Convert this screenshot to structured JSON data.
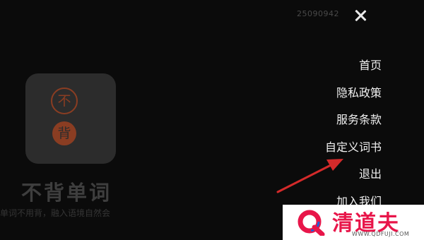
{
  "header": {
    "user_id": "25090942"
  },
  "background_card": {
    "logo_top_char": "不",
    "logo_bottom_char": "背",
    "app_name": "不背单词",
    "tagline": "单词不用背，融入语境自然会"
  },
  "menu": {
    "items": [
      {
        "label": "首页"
      },
      {
        "label": "隐私政策"
      },
      {
        "label": "服务条款"
      },
      {
        "label": "自定义词书"
      },
      {
        "label": "退出"
      },
      {
        "label": "加入我们"
      }
    ]
  },
  "annotation": {
    "color": "#d42a2a",
    "points_to": "自定义词书"
  },
  "watermark": {
    "brand": "清道夫",
    "url": "WWW.QDFUJI.COM",
    "brand_color": "#e8164a"
  }
}
